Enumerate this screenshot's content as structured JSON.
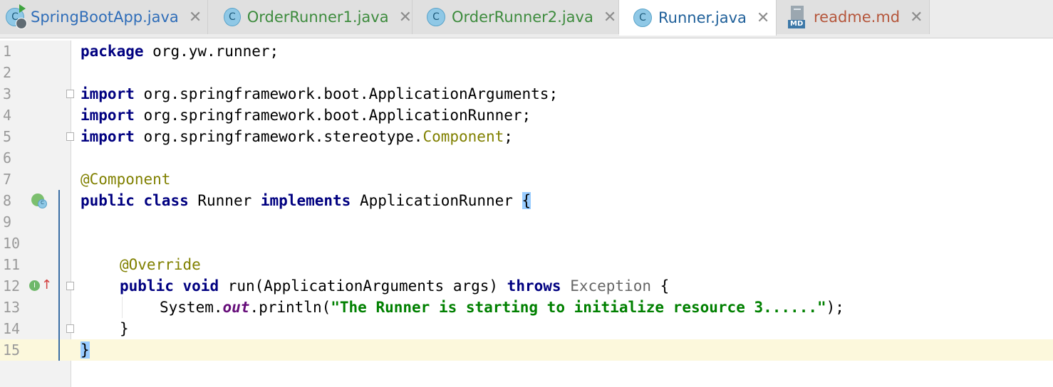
{
  "tabs": [
    {
      "label": "SpringBootApp.java",
      "icon": "spring-boot-class-icon",
      "color": "#2f6db8"
    },
    {
      "label": "OrderRunner1.java",
      "icon": "class-icon",
      "color": "#3d8b3d"
    },
    {
      "label": "OrderRunner2.java",
      "icon": "class-icon",
      "color": "#3d8b3d"
    },
    {
      "label": "Runner.java",
      "icon": "class-icon",
      "color": "#1e5f99"
    },
    {
      "label": "readme.md",
      "icon": "markdown-file-icon",
      "color": "#b5563b"
    }
  ],
  "active_tab": "Runner.java",
  "close_glyph": "✕",
  "tab_icon_letter": "C",
  "md_badge": "MD",
  "line_numbers": [
    "1",
    "2",
    "3",
    "4",
    "5",
    "6",
    "7",
    "8",
    "9",
    "10",
    "11",
    "12",
    "13",
    "14",
    "15"
  ],
  "code": {
    "l1_kw": "package",
    "l1_rest": " org.yw.runner;",
    "import_kw": "import",
    "l3_rest": " org.springframework.boot.ApplicationArguments;",
    "l4_rest": " org.springframework.boot.ApplicationRunner;",
    "l5_pre": " org.springframework.stereotype.",
    "l5_cls": "Component",
    "l5_end": ";",
    "l7_ann": "@Component",
    "l8_kw1": "public",
    "l8_kw2": "class",
    "l8_name": " Runner ",
    "l8_kw3": "implements",
    "l8_iface": " ApplicationRunner ",
    "l8_brace": "{",
    "l11_ann": "@Override",
    "l12_kw1": "public",
    "l12_kw2": "void",
    "l12_sig": " run(ApplicationArguments args) ",
    "l12_kw3": "throws",
    "l12_exc": "Exception",
    "l12_brace": " {",
    "l13_pre": "System.",
    "l13_field": "out",
    "l13_call": ".println(",
    "l13_str": "\"The Runner is starting to initialize resource 3......\"",
    "l13_end": ");",
    "l14": "}",
    "l15": "}"
  },
  "gutter_icons": {
    "implemented_badge": "I",
    "override_arrow": "↑"
  }
}
